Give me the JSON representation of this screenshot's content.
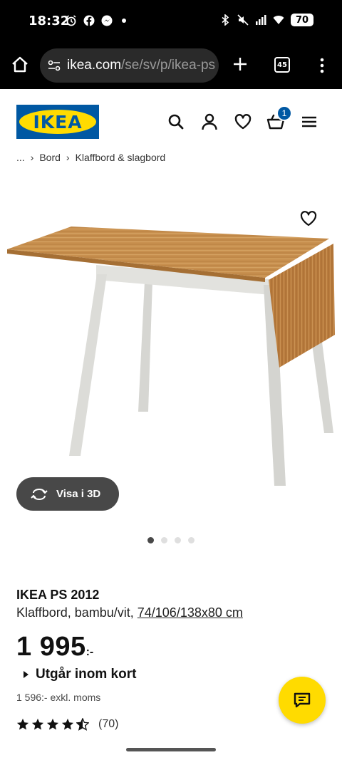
{
  "status_bar": {
    "time": "18:32",
    "battery": "70"
  },
  "browser": {
    "url_host": "ikea.com",
    "url_path": "/se/sv/p/ikea-ps",
    "tab_count": "45"
  },
  "header": {
    "logo_text": "IKEA",
    "cart_count": "1"
  },
  "breadcrumb": {
    "ellipsis": "...",
    "items": [
      "Bord",
      "Klaffbord & slagbord"
    ]
  },
  "gallery": {
    "view_3d_label": "Visa i 3D",
    "image_count": 4,
    "active_index": 0
  },
  "product": {
    "name": "IKEA PS 2012",
    "description": "Klaffbord, bambu/vit, ",
    "size": "74/106/138x80 cm",
    "price_integer": "1 995",
    "price_suffix": ":-",
    "notice": "Utgår inom kort",
    "price_excl_vat": "1 596:- exkl. moms",
    "rating_stars": 4.5,
    "rating_count": "(70)"
  },
  "colors": {
    "ikea_blue": "#0058a3",
    "ikea_yellow": "#ffdb00"
  }
}
